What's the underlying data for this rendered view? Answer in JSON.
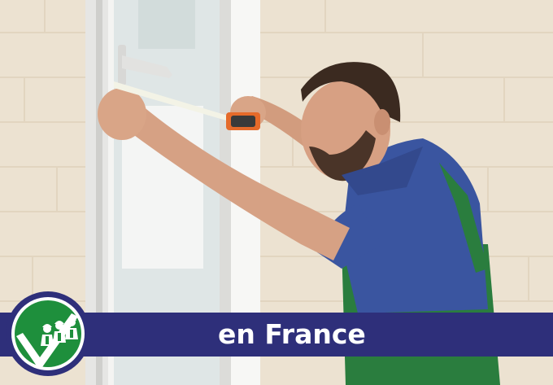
{
  "banner": {
    "text": "en France"
  },
  "colors": {
    "banner": "#2e2f7a",
    "logo_ring": "#2e2f7a",
    "logo_fill": "#1e8f3c",
    "wall": "#eadfcd",
    "shirt": "#3a55a0",
    "overalls": "#2a7d3e"
  },
  "logo": {
    "icon": "check-workers-icon"
  }
}
